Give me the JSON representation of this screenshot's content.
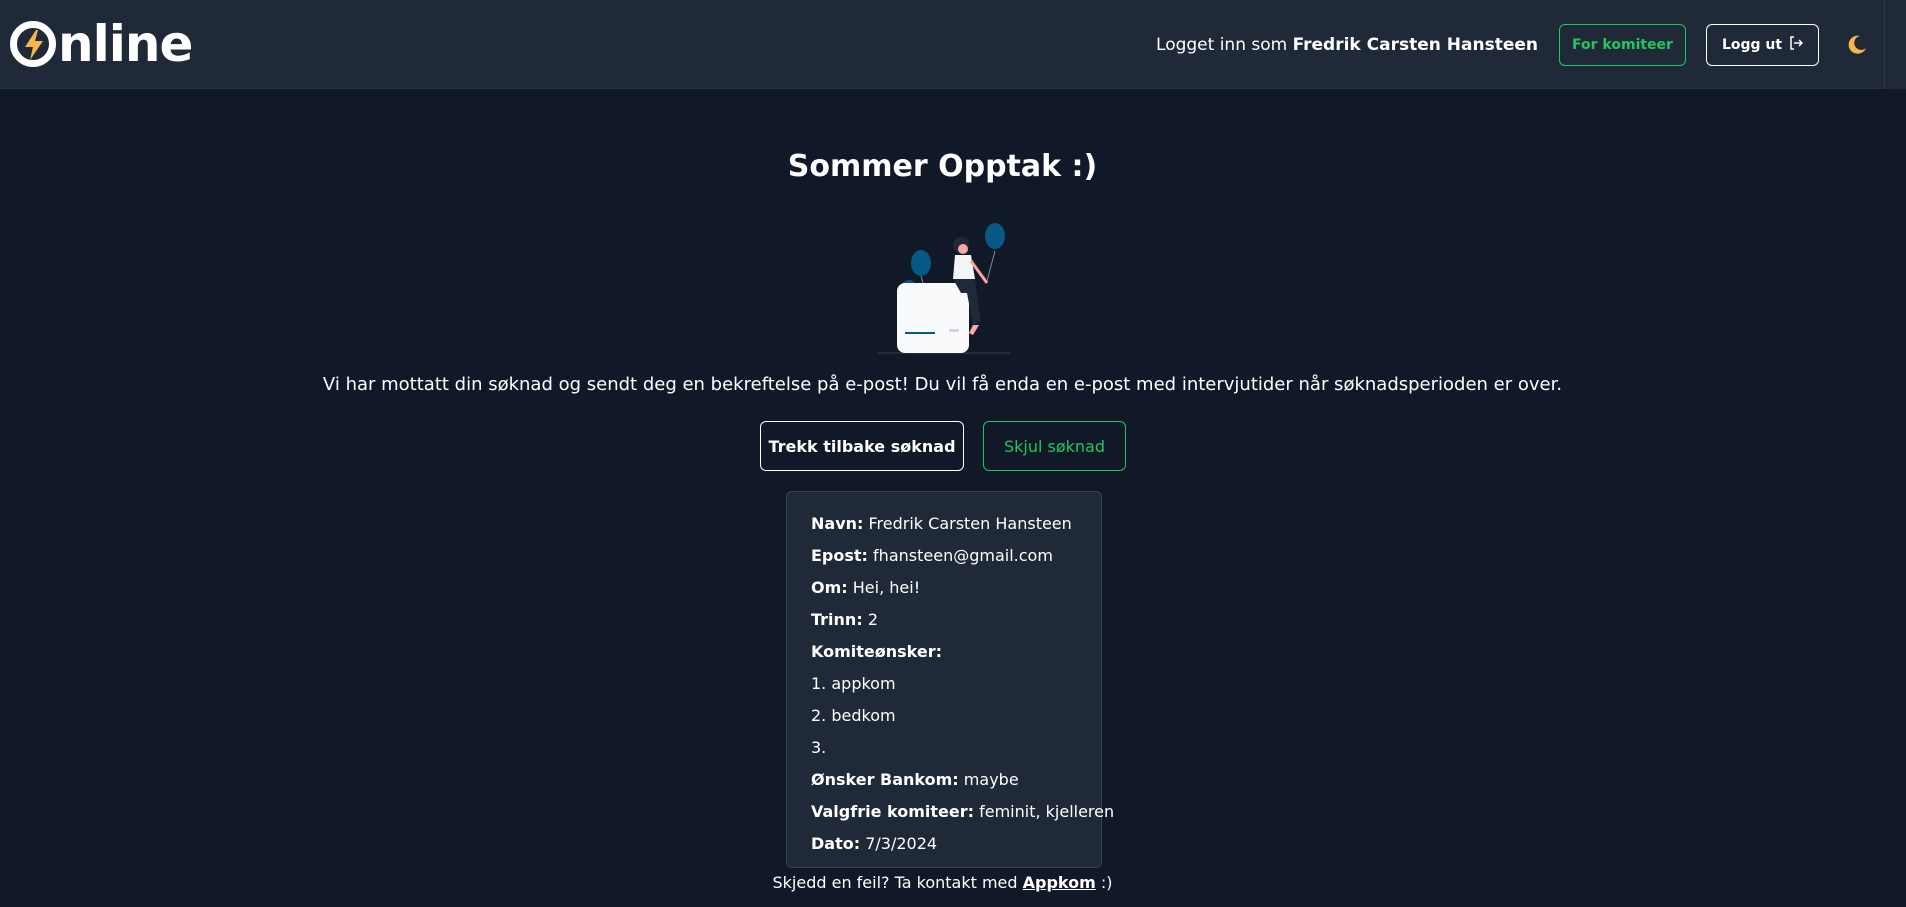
{
  "header": {
    "logo_text": "nline",
    "logged_in_prefix": "Logget inn som ",
    "logged_in_name": "Fredrik Carsten Hansteen",
    "committee_button": "For komiteer",
    "logout_button": "Logg ut"
  },
  "main": {
    "title": "Sommer Opptak :)",
    "message": "Vi har mottatt din søknad og sendt deg en bekreftelse på e-post! Du vil få enda en e-post med intervjutider når søknadsperioden er over.",
    "withdraw_button": "Trekk tilbake søknad",
    "hide_button": "Skjul søknad"
  },
  "application": {
    "name_label": "Navn:",
    "name": "Fredrik Carsten Hansteen",
    "email_label": "Epost:",
    "email": "fhansteen@gmail.com",
    "about_label": "Om:",
    "about": "Hei, hei!",
    "grade_label": "Trinn:",
    "grade": "2",
    "wishes_label": "Komiteønsker:",
    "wishes": [
      "1. appkom",
      "2. bedkom",
      "3."
    ],
    "bankom_label": "Ønsker Bankom:",
    "bankom": "maybe",
    "optional_label": "Valgfrie komiteer:",
    "optional": "feminit, kjelleren",
    "date_label": "Dato:",
    "date": "7/3/2024"
  },
  "footer": {
    "prefix": "Skjedd en feil? Ta kontakt med ",
    "link": "Appkom",
    "suffix": " :)"
  },
  "colors": {
    "background": "#111827",
    "header": "#1f2937",
    "accent_green": "#22c55e",
    "moon": "#f6b649"
  },
  "icons": {
    "logo": "lightning-bolt-icon",
    "logout": "logout-arrow-icon",
    "theme": "moon-icon"
  }
}
